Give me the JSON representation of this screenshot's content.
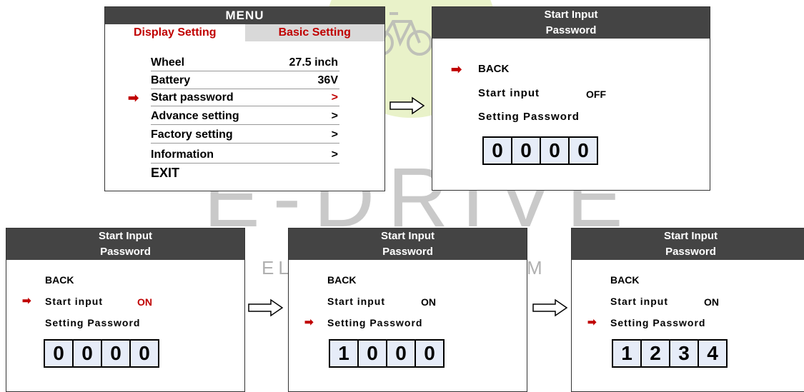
{
  "menu": {
    "title": "MENU",
    "tab_display": "Display Setting",
    "tab_basic": "Basic Setting",
    "items": [
      {
        "label": "Wheel",
        "value": "27.5 inch"
      },
      {
        "label": "Battery",
        "value": "36V"
      },
      {
        "label": "Start password",
        "value": ">"
      },
      {
        "label": "Advance setting",
        "value": ">"
      },
      {
        "label": "Factory setting",
        "value": ">"
      },
      {
        "label": "Information",
        "value": ">"
      }
    ],
    "exit": "EXIT"
  },
  "panels": [
    {
      "title1": "Start Input",
      "title2": "Password",
      "back": "BACK",
      "start_input": "Start input",
      "state": "OFF",
      "setting": "Setting Password",
      "digits": [
        "0",
        "0",
        "0",
        "0"
      ]
    },
    {
      "title1": "Start Input",
      "title2": "Password",
      "back": "BACK",
      "start_input": "Start input",
      "state": "ON",
      "setting": "Setting Password",
      "digits": [
        "0",
        "0",
        "0",
        "0"
      ]
    },
    {
      "title1": "Start Input",
      "title2": "Password",
      "back": "BACK",
      "start_input": "Start input",
      "state": "ON",
      "setting": "Setting Password",
      "digits": [
        "1",
        "0",
        "0",
        "0"
      ]
    },
    {
      "title1": "Start Input",
      "title2": "Password",
      "back": "BACK",
      "start_input": "Start input",
      "state": "ON",
      "setting": "Setting Password",
      "digits": [
        "1",
        "2",
        "3",
        "4"
      ]
    }
  ],
  "watermark": {
    "brand": "E-DRIVE",
    "sub": "EL",
    "sub2": "M"
  },
  "selector_arrow": "➡",
  "colors": {
    "header_bg": "#444444",
    "accent_red": "#c00000",
    "tab_active_bg": "#d9d9d9"
  }
}
